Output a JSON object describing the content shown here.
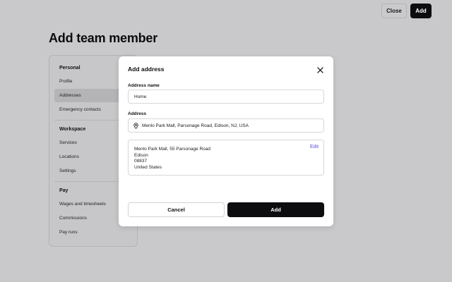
{
  "topbar": {
    "close_label": "Close",
    "add_label": "Add"
  },
  "page": {
    "title": "Add team member"
  },
  "sidebar": {
    "sections": [
      {
        "title": "Personal",
        "items": [
          "Profile",
          "Addresses",
          "Emergency contacts"
        ]
      },
      {
        "title": "Workspace",
        "items": [
          "Services",
          "Locations",
          "Settings"
        ]
      },
      {
        "title": "Pay",
        "items": [
          "Wages and timesheets",
          "Commissions",
          "Pay runs"
        ]
      }
    ],
    "active_item": "Addresses"
  },
  "modal": {
    "title": "Add address",
    "close_icon": "close-icon",
    "address_name": {
      "label": "Address name",
      "value": "Home"
    },
    "address": {
      "label": "Address",
      "icon": "location-pin-icon",
      "value": "Menlo Park Mall, Parsonage Road, Edison, NJ, USA"
    },
    "resolved": {
      "lines": [
        "Menlo Park Mall, 55 Parsonage Road",
        "Edison",
        "08837",
        "United States"
      ],
      "edit_label": "Edit"
    },
    "cancel_label": "Cancel",
    "add_label": "Add"
  },
  "colors": {
    "overlay_bg": "#c9c9cb",
    "primary": "#0d0d0f",
    "link": "#5b4fe0"
  }
}
